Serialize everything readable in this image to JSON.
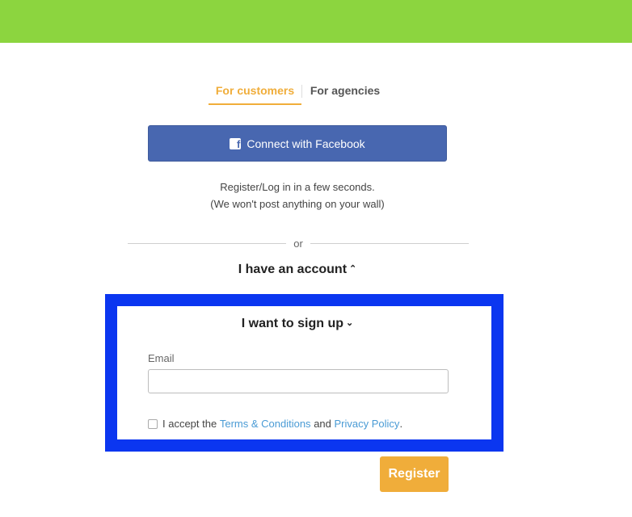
{
  "header": {
    "bar_color": "#8cd53f"
  },
  "tabs": [
    {
      "label": "For customers",
      "active": true
    },
    {
      "label": "For agencies",
      "active": false
    }
  ],
  "facebook": {
    "label": "Connect with Facebook",
    "icon": "facebook-icon",
    "color": "#4867b0"
  },
  "info": {
    "line1": "Register/Log in in a few seconds.",
    "line2": "(We won't post anything on your wall)"
  },
  "divider": {
    "text": "or"
  },
  "account_toggle": {
    "label": "I have an account",
    "chevron": "^"
  },
  "signup": {
    "label": "I want to sign up",
    "chevron": "⌄",
    "email_label": "Email",
    "email_value": "",
    "email_placeholder": "",
    "terms_prefix": "I accept the",
    "terms_link": "Terms & Conditions",
    "terms_and": "and",
    "privacy_link": "Privacy Policy",
    "terms_suffix": ".",
    "highlight_color": "#0b36f0"
  },
  "register": {
    "label": "Register",
    "color": "#f0ad3a"
  }
}
